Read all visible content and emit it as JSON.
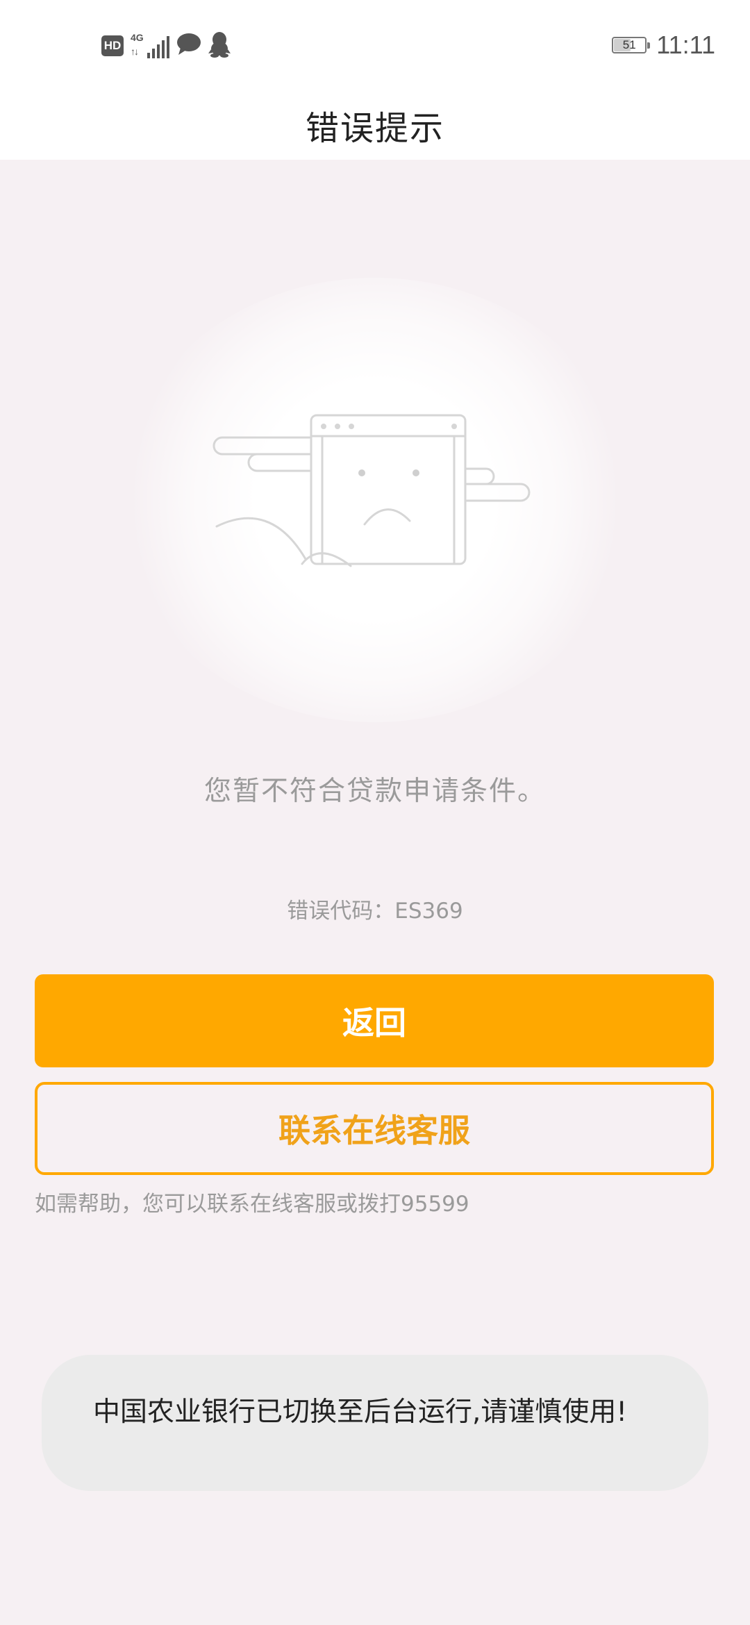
{
  "status_bar": {
    "network_badge": "HD",
    "network_type": "4G",
    "network_arrows": "↑↓",
    "battery_level": "51",
    "time": "11:11",
    "icons": [
      "hd-icon",
      "signal-icon",
      "message-bubble-icon",
      "qq-penguin-icon",
      "battery-icon"
    ]
  },
  "header": {
    "title": "错误提示"
  },
  "error": {
    "illustration": "sad-window-icon",
    "message": "您暂不符合贷款申请条件。",
    "code_text": "错误代码：ES369"
  },
  "actions": {
    "back_label": "返回",
    "service_label": "联系在线客服",
    "help_text": "如需帮助，您可以联系在线客服或拨打95599"
  },
  "toast": {
    "text": "中国农业银行已切换至后台运行,请谨慎使用!"
  },
  "colors": {
    "accent": "#ffa800",
    "background": "#f6f0f3",
    "muted_text": "#9a9a9a",
    "toast_bg": "#ebebeb"
  }
}
